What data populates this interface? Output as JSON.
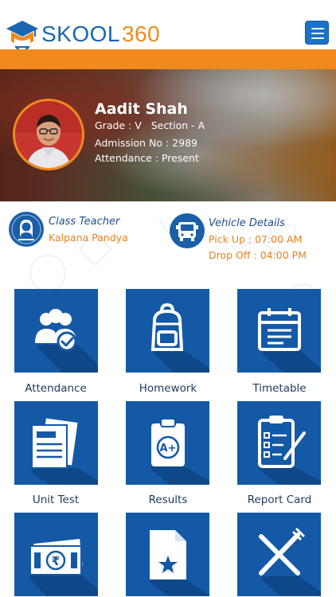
{
  "header": {
    "brand_part1": "SKOOL",
    "brand_part2": "360",
    "logo_icon": "graduation-cap-shield-icon",
    "menu_icon": "hamburger-menu-icon"
  },
  "colors": {
    "primary_blue": "#1459a6",
    "accent_orange": "#f08a1c",
    "menu_blue": "#1a73c8"
  },
  "student": {
    "name": "Aadit Shah",
    "grade_line": "Grade : V   Section - A",
    "admission_line": "Admission No : 2989",
    "attendance_line": "Attendance : Present"
  },
  "class_teacher": {
    "title": "Class Teacher",
    "name": "Kalpana Pandya",
    "icon": "teacher-icon"
  },
  "vehicle": {
    "title": "Vehicle Details",
    "pickup": "Pick Up : 07:00 AM",
    "dropoff": "Drop Off : 04:00 PM",
    "icon": "bus-icon"
  },
  "tiles": [
    {
      "label": "Attendance",
      "icon": "attendance-group-check-icon"
    },
    {
      "label": "Homework",
      "icon": "backpack-icon"
    },
    {
      "label": "Timetable",
      "icon": "calendar-icon"
    },
    {
      "label": "Unit Test",
      "icon": "test-papers-icon"
    },
    {
      "label": "Results",
      "icon": "grade-clipboard-icon"
    },
    {
      "label": "Report Card",
      "icon": "checklist-clipboard-icon"
    },
    {
      "label": "",
      "icon": "rupee-banknotes-icon"
    },
    {
      "label": "",
      "icon": "star-document-icon"
    },
    {
      "label": "",
      "icon": "fork-knife-icon"
    }
  ]
}
